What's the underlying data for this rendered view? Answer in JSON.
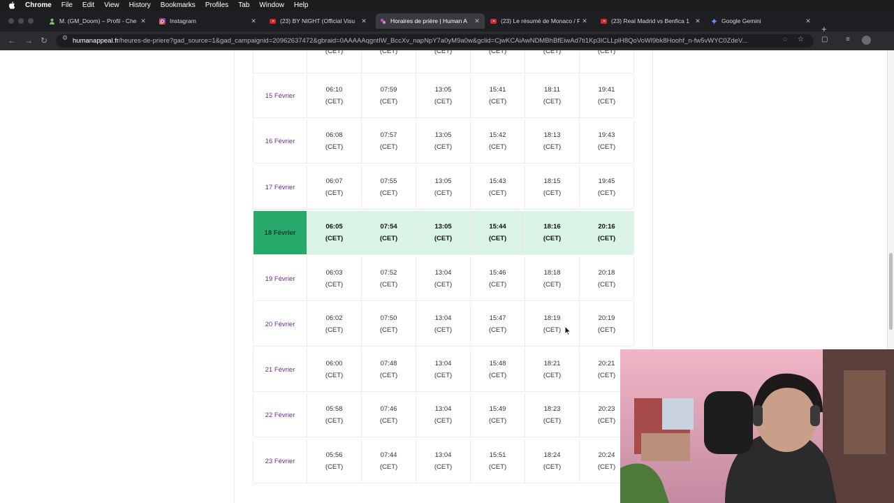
{
  "menubar": {
    "app": "Chrome",
    "items": [
      "File",
      "Edit",
      "View",
      "History",
      "Bookmarks",
      "Profiles",
      "Tab",
      "Window",
      "Help"
    ]
  },
  "tabs": [
    {
      "title": "M. (GM_Doom) – Profil - Che",
      "icon": "profile-icon"
    },
    {
      "title": "Instagram",
      "icon": "instagram-icon"
    },
    {
      "title": "(23) BY NIGHT (Official Visu",
      "icon": "youtube-icon"
    },
    {
      "title": "Horaires de prière | Human A",
      "icon": "humanappeal-icon",
      "active": true
    },
    {
      "title": "(23) Le résumé de Monaco / F",
      "icon": "youtube-icon"
    },
    {
      "title": "(23) Real Madrid vs Benfica 1",
      "icon": "youtube-icon"
    },
    {
      "title": "Google Gemini",
      "icon": "gemini-icon"
    }
  ],
  "address": {
    "site": "humanappeal.fr",
    "path": "/heures-de-priere?gad_source=1&gad_campaignid=20962637472&gbraid=0AAAAAqgntIW_BccXv_napNpY7a0yM9a0w&gclid=CjwKCAiAwNDMBhBfEiwAd7ti1Kp3lCLLplH8QoVoWl9bk8Hoohf_n-fw5vWYC0ZdeV..."
  },
  "table": {
    "partial_top": [
      "(CET)",
      "(CET)",
      "(CET)",
      "(CET)",
      "(CET)",
      "(CET)"
    ],
    "rows": [
      {
        "date": "15 Février",
        "times": [
          "06:10",
          "07:59",
          "13:05",
          "15:41",
          "18:11",
          "19:41"
        ],
        "tz": "(CET)"
      },
      {
        "date": "16 Février",
        "times": [
          "06:08",
          "07:57",
          "13:05",
          "15:42",
          "18:13",
          "19:43"
        ],
        "tz": "(CET)"
      },
      {
        "date": "17 Février",
        "times": [
          "06:07",
          "07:55",
          "13:05",
          "15:43",
          "18:15",
          "19:45"
        ],
        "tz": "(CET)"
      },
      {
        "date": "18 Février",
        "times": [
          "06:05",
          "07:54",
          "13:05",
          "15:44",
          "18:16",
          "20:16"
        ],
        "tz": "(CET)",
        "highlight": true
      },
      {
        "date": "19 Février",
        "times": [
          "06:03",
          "07:52",
          "13:04",
          "15:46",
          "18:18",
          "20:18"
        ],
        "tz": "(CET)"
      },
      {
        "date": "20 Février",
        "times": [
          "06:02",
          "07:50",
          "13:04",
          "15:47",
          "18:19",
          "20:19"
        ],
        "tz": "(CET)"
      },
      {
        "date": "21 Février",
        "times": [
          "06:00",
          "07:48",
          "13:04",
          "15:48",
          "18:21",
          "20:21"
        ],
        "tz": "(CET)"
      },
      {
        "date": "22 Février",
        "times": [
          "05:58",
          "07:46",
          "13:04",
          "15:49",
          "18:23",
          "20:23"
        ],
        "tz": "(CET)"
      },
      {
        "date": "23 Février",
        "times": [
          "05:56",
          "07:44",
          "13:04",
          "15:51",
          "18:24",
          "20:24"
        ],
        "tz": "(CET)"
      }
    ]
  },
  "colors": {
    "highlight_date": "#26a96a",
    "highlight_cells": "#d9f3e4",
    "date_text": "#6b2f8e"
  }
}
